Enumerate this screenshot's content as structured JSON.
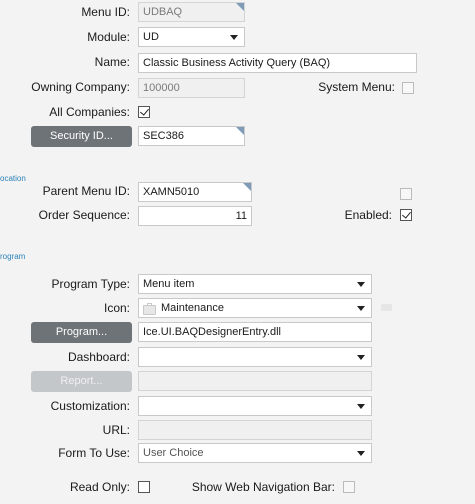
{
  "menu_id": {
    "label": "Menu ID:",
    "value": "UDBAQ"
  },
  "module": {
    "label": "Module:",
    "value": "UD"
  },
  "name": {
    "label": "Name:",
    "value": "Classic Business Activity Query (BAQ)"
  },
  "owning_company": {
    "label": "Owning Company:",
    "value": "100000"
  },
  "system_menu": {
    "label": "System Menu:",
    "checked": false
  },
  "all_companies": {
    "label": "All Companies:",
    "checked": true
  },
  "security": {
    "button_label": "Security ID...",
    "value": "SEC386"
  },
  "section_location": {
    "title": "ocation"
  },
  "parent_menu_id": {
    "label": "Parent Menu ID:",
    "value": "XAMN5010",
    "extra_checked": false
  },
  "order_sequence": {
    "label": "Order Sequence:",
    "value": "11"
  },
  "enabled": {
    "label": "Enabled:",
    "checked": true
  },
  "section_program": {
    "title": "rogram"
  },
  "program_type": {
    "label": "Program Type:",
    "value": "Menu item"
  },
  "icon": {
    "label": "Icon:",
    "value": "Maintenance",
    "icon_name": "briefcase-icon"
  },
  "program": {
    "button_label": "Program...",
    "value": "Ice.UI.BAQDesignerEntry.dll"
  },
  "dashboard": {
    "label": "Dashboard:",
    "value": ""
  },
  "report": {
    "button_label": "Report...",
    "value": ""
  },
  "customization": {
    "label": "Customization:",
    "value": ""
  },
  "url": {
    "label": "URL:",
    "value": ""
  },
  "form_to_use": {
    "label": "Form To Use:",
    "value": "User Choice"
  },
  "read_only": {
    "label": "Read Only:",
    "checked": false
  },
  "show_web_nav": {
    "label": "Show Web Navigation Bar:",
    "checked": false
  },
  "colors": {
    "accent": "#2b82b8",
    "button": "#6e7378",
    "button_disabled": "#c4c7ca",
    "corner_marker": "#7f9bb8"
  }
}
